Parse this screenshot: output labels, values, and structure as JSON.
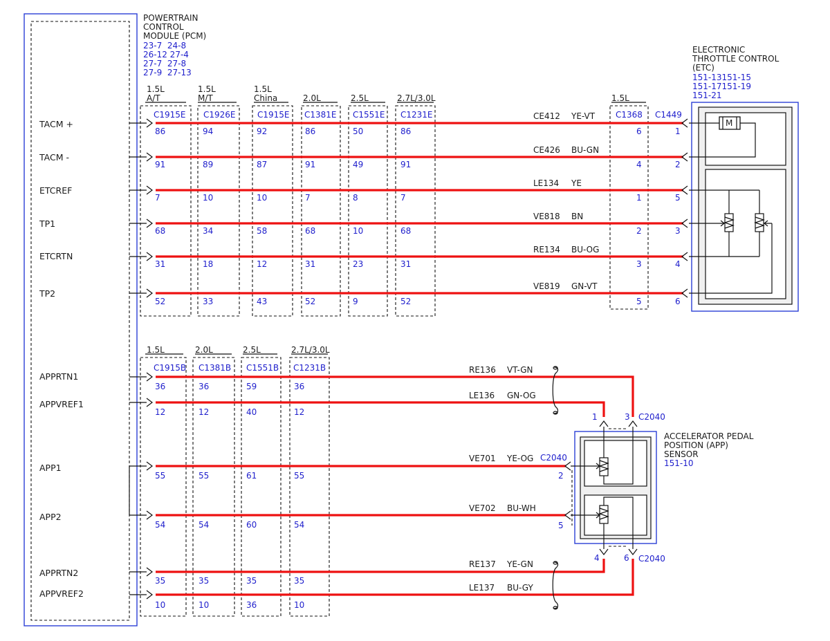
{
  "pcm": {
    "title": [
      "POWERTRAIN",
      "CONTROL",
      "MODULE (PCM)"
    ],
    "refs": [
      "23-7  24-8",
      "26-12 27-4",
      "27-7  27-8",
      "27-9  27-13"
    ]
  },
  "etc": {
    "title": [
      "ELECTRONIC",
      "THROTTLE CONTROL",
      "(ETC)"
    ],
    "refs": [
      "151-13151-15",
      "151-17151-19",
      "151-21"
    ],
    "connector": "C1449",
    "inline_variant": "1.5L",
    "inline_connector": "C1368",
    "motor_symbol": "M"
  },
  "app": {
    "title": [
      "ACCELERATOR PEDAL",
      "POSITION (APP)",
      "SENSOR"
    ],
    "refs": [
      "151-10"
    ],
    "connector": "C2040"
  },
  "top_columns": [
    {
      "variant": [
        "1.5L",
        "A/T"
      ],
      "connector": "C1915E"
    },
    {
      "variant": [
        "1.5L",
        "M/T"
      ],
      "connector": "C1926E"
    },
    {
      "variant": [
        "1.5L",
        "China"
      ],
      "connector": "C1915E"
    },
    {
      "variant": [
        "2.0L"
      ],
      "connector": "C1381E"
    },
    {
      "variant": [
        "2.5L"
      ],
      "connector": "C1551E"
    },
    {
      "variant": [
        "2.7L/3.0L"
      ],
      "connector": "C1231E"
    }
  ],
  "top_signals": [
    {
      "name": "TACM +",
      "circuit": "CE412",
      "color": "YE-VT",
      "pins": [
        "86",
        "94",
        "92",
        "86",
        "50",
        "86"
      ],
      "c1368_pin": "6",
      "c1449_pin": "1"
    },
    {
      "name": "TACM -",
      "circuit": "CE426",
      "color": "BU-GN",
      "pins": [
        "91",
        "89",
        "87",
        "91",
        "49",
        "91"
      ],
      "c1368_pin": "4",
      "c1449_pin": "2"
    },
    {
      "name": "ETCREF",
      "circuit": "LE134",
      "color": "YE",
      "pins": [
        "7",
        "10",
        "10",
        "7",
        "8",
        "7"
      ],
      "c1368_pin": "1",
      "c1449_pin": "5"
    },
    {
      "name": "TP1",
      "circuit": "VE818",
      "color": "BN",
      "pins": [
        "68",
        "34",
        "58",
        "68",
        "10",
        "68"
      ],
      "c1368_pin": "2",
      "c1449_pin": "3"
    },
    {
      "name": "ETCRTN",
      "circuit": "RE134",
      "color": "BU-OG",
      "pins": [
        "31",
        "18",
        "12",
        "31",
        "23",
        "31"
      ],
      "c1368_pin": "3",
      "c1449_pin": "4"
    },
    {
      "name": "TP2",
      "circuit": "VE819",
      "color": "GN-VT",
      "pins": [
        "52",
        "33",
        "43",
        "52",
        "9",
        "52"
      ],
      "c1368_pin": "5",
      "c1449_pin": "6"
    }
  ],
  "bottom_columns": [
    {
      "variant": [
        "1.5L"
      ],
      "connector": "C1915B"
    },
    {
      "variant": [
        "2.0L"
      ],
      "connector": "C1381B"
    },
    {
      "variant": [
        "2.5L"
      ],
      "connector": "C1551B"
    },
    {
      "variant": [
        "2.7L/3.0L"
      ],
      "connector": "C1231B"
    }
  ],
  "bottom_signals": [
    {
      "name": "APPRTN1",
      "circuit": "RE136",
      "color": "VT-GN",
      "pins": [
        "36",
        "36",
        "59",
        "36"
      ],
      "app_pin": "3"
    },
    {
      "name": "APPVREF1",
      "circuit": "LE136",
      "color": "GN-OG",
      "pins": [
        "12",
        "12",
        "40",
        "12"
      ],
      "app_pin": "1"
    },
    {
      "name": "APP1",
      "circuit": "VE701",
      "color": "YE-OG",
      "pins": [
        "55",
        "55",
        "61",
        "55"
      ],
      "app_pin": "2"
    },
    {
      "name": "APP2",
      "circuit": "VE702",
      "color": "BU-WH",
      "pins": [
        "54",
        "54",
        "60",
        "54"
      ],
      "app_pin": "5"
    },
    {
      "name": "APPRTN2",
      "circuit": "RE137",
      "color": "YE-GN",
      "pins": [
        "35",
        "35",
        "35",
        "35"
      ],
      "app_pin": "4"
    },
    {
      "name": "APPVREF2",
      "circuit": "LE137",
      "color": "BU-GY",
      "pins": [
        "10",
        "10",
        "36",
        "10"
      ],
      "app_pin": "6"
    }
  ],
  "colors": {
    "wire": "#ee1111",
    "module_border": "#2a3fd6",
    "reference_text": "#1e1ecc"
  }
}
